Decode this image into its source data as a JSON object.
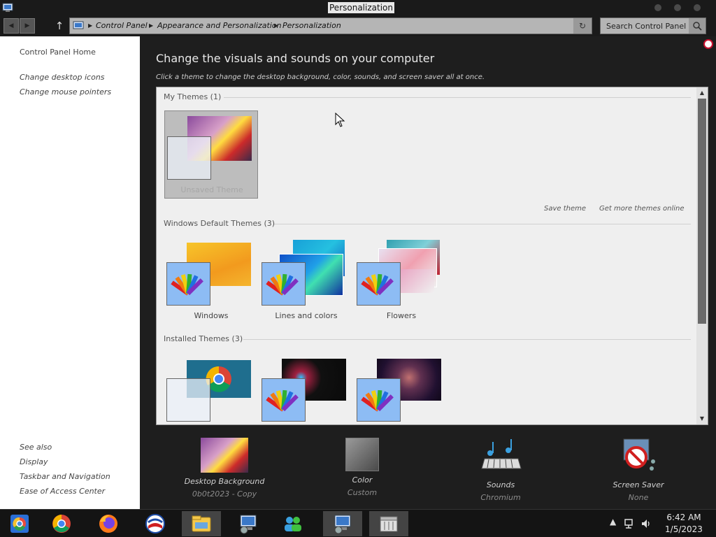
{
  "window": {
    "title": "Personalization"
  },
  "address": {
    "crumbs": [
      "Control Panel",
      "Appearance and Personalization",
      "Personalization"
    ],
    "search_placeholder": "Search Control Panel"
  },
  "sidebar": {
    "home": "Control Panel Home",
    "links": [
      "Change desktop icons",
      "Change mouse pointers"
    ],
    "see_also_title": "See also",
    "see_also": [
      "Display",
      "Taskbar and Navigation",
      "Ease of Access Center"
    ]
  },
  "main": {
    "heading": "Change the visuals and sounds on your computer",
    "subheading": "Click a theme to change the desktop background, color, sounds, and screen saver all at once.",
    "my_themes_title": "My Themes (1)",
    "my_themes": [
      {
        "label": "Unsaved Theme"
      }
    ],
    "save_theme": "Save theme",
    "get_more": "Get more themes online",
    "default_title": "Windows Default Themes (3)",
    "default_themes": [
      {
        "label": "Windows"
      },
      {
        "label": "Lines and colors"
      },
      {
        "label": "Flowers"
      }
    ],
    "installed_title": "Installed Themes (3)"
  },
  "customize": [
    {
      "label": "Desktop Background",
      "value": "0b0t2023 - Copy"
    },
    {
      "label": "Color",
      "value": "Custom"
    },
    {
      "label": "Sounds",
      "value": "Chromium"
    },
    {
      "label": "Screen Saver",
      "value": "None"
    }
  ],
  "clock": {
    "time": "6:42 AM",
    "date": "1/5/2023"
  }
}
